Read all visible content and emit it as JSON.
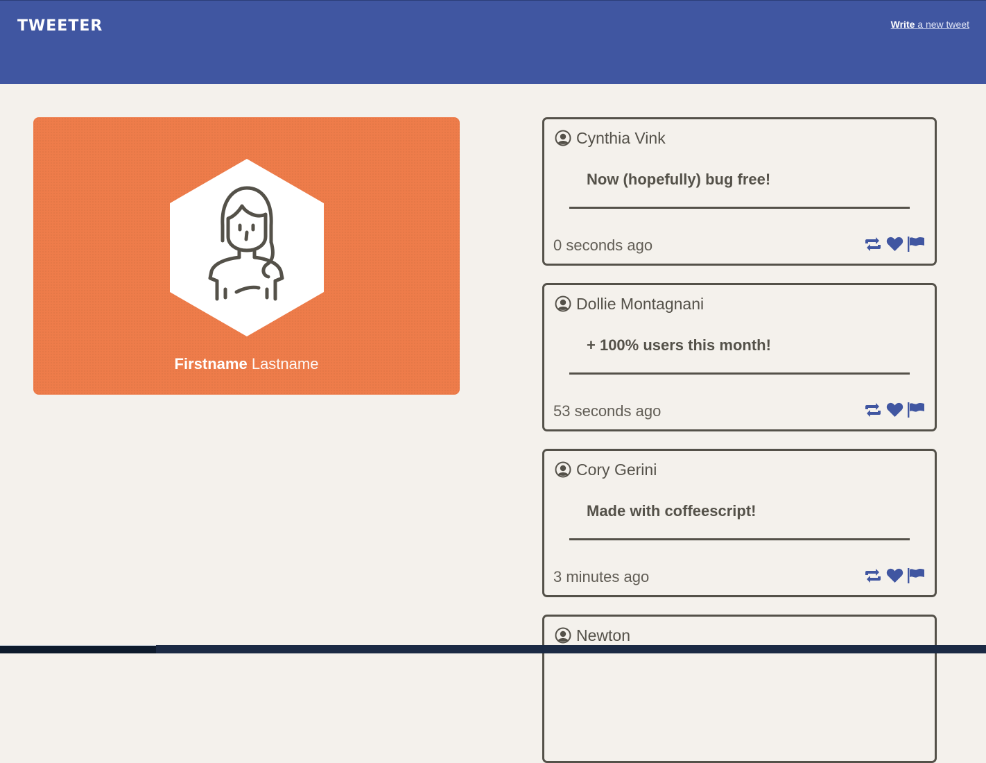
{
  "header": {
    "brand": "TWEETER",
    "compose_bold": "Write",
    "compose_rest": "a new tweet"
  },
  "profile": {
    "first_name": "Firstname",
    "last_name": "Lastname"
  },
  "tweets": [
    {
      "author": "Cynthia Vink",
      "text": "Now (hopefully) bug free!",
      "time": "0 seconds ago"
    },
    {
      "author": "Dollie Montagnani",
      "text": "+ 100% users this month!",
      "time": "53 seconds ago"
    },
    {
      "author": "Cory Gerini",
      "text": "Made with coffeescript!",
      "time": "3 minutes ago"
    },
    {
      "author": "Newton",
      "text": "",
      "time": ""
    }
  ],
  "icons": {
    "retweet": "retweet-icon",
    "like": "heart-icon",
    "flag": "flag-icon",
    "user": "user-circle-icon"
  },
  "colors": {
    "header_bg": "#4056a1",
    "accent_orange": "#ee7c4a",
    "page_bg": "#f4f1ec",
    "text_dark": "#545149"
  }
}
